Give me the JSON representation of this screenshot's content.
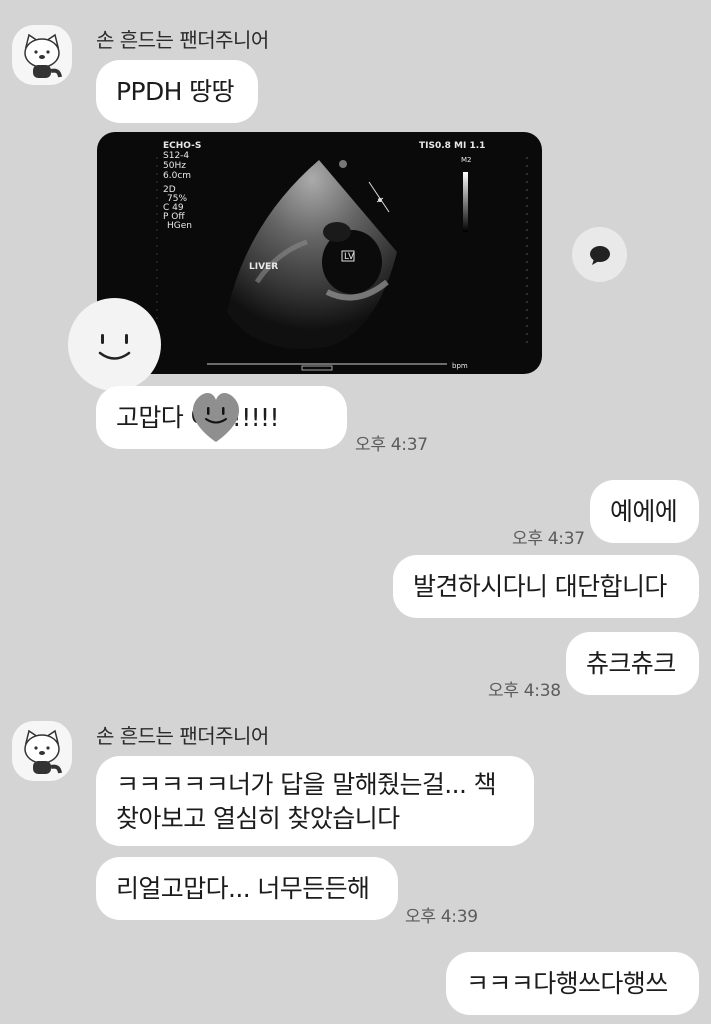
{
  "chat": {
    "sender_name": "손 흔드는 팬더주니어",
    "groups": [
      {
        "sender": "손 흔드는 팬더주니어",
        "messages": [
          "PPDH 땅땅",
          "고맙다 아!!!!!!!"
        ],
        "time": "오후 4:37"
      },
      {
        "mine": true,
        "messages": [
          "예에에",
          "발견하시다니 대단합니다",
          "츄크츄크"
        ],
        "times": [
          "오후 4:37",
          "오후 4:38"
        ]
      },
      {
        "sender": "손 흔드는 팬더주니어",
        "messages": [
          "ㅋㅋㅋㅋㅋ너가 답을 말해줬는걸... 책 찾아보고 열심히 찾았습니다",
          "리얼고맙다... 너무든든해"
        ],
        "time": "오후 4:39"
      },
      {
        "mine": true,
        "messages": [
          "ㅋㅋㅋ다행쓰다행쓰"
        ]
      }
    ]
  },
  "ultrasound": {
    "header_left": "ECHO-S",
    "probe": "S12-4",
    "freq": "50Hz",
    "depth": "6.0cm",
    "settings": [
      "2D",
      "75%",
      "C 49",
      "P Off",
      "HGen"
    ],
    "index": "TIS0.8  MI 1.1",
    "liver_label": "LIVER",
    "lv_label": "LV",
    "m2_label": "M2",
    "bpm_label": "bpm"
  },
  "icons": {
    "comment": "speech-bubble-icon",
    "avatar": "raccoon-avatar-icon",
    "sticker": "smiley-face-sticker",
    "heart": "heart-sticker"
  },
  "colors": {
    "background": "#d4d4d4",
    "bubble": "#ffffff",
    "time": "#5b5b5b"
  }
}
